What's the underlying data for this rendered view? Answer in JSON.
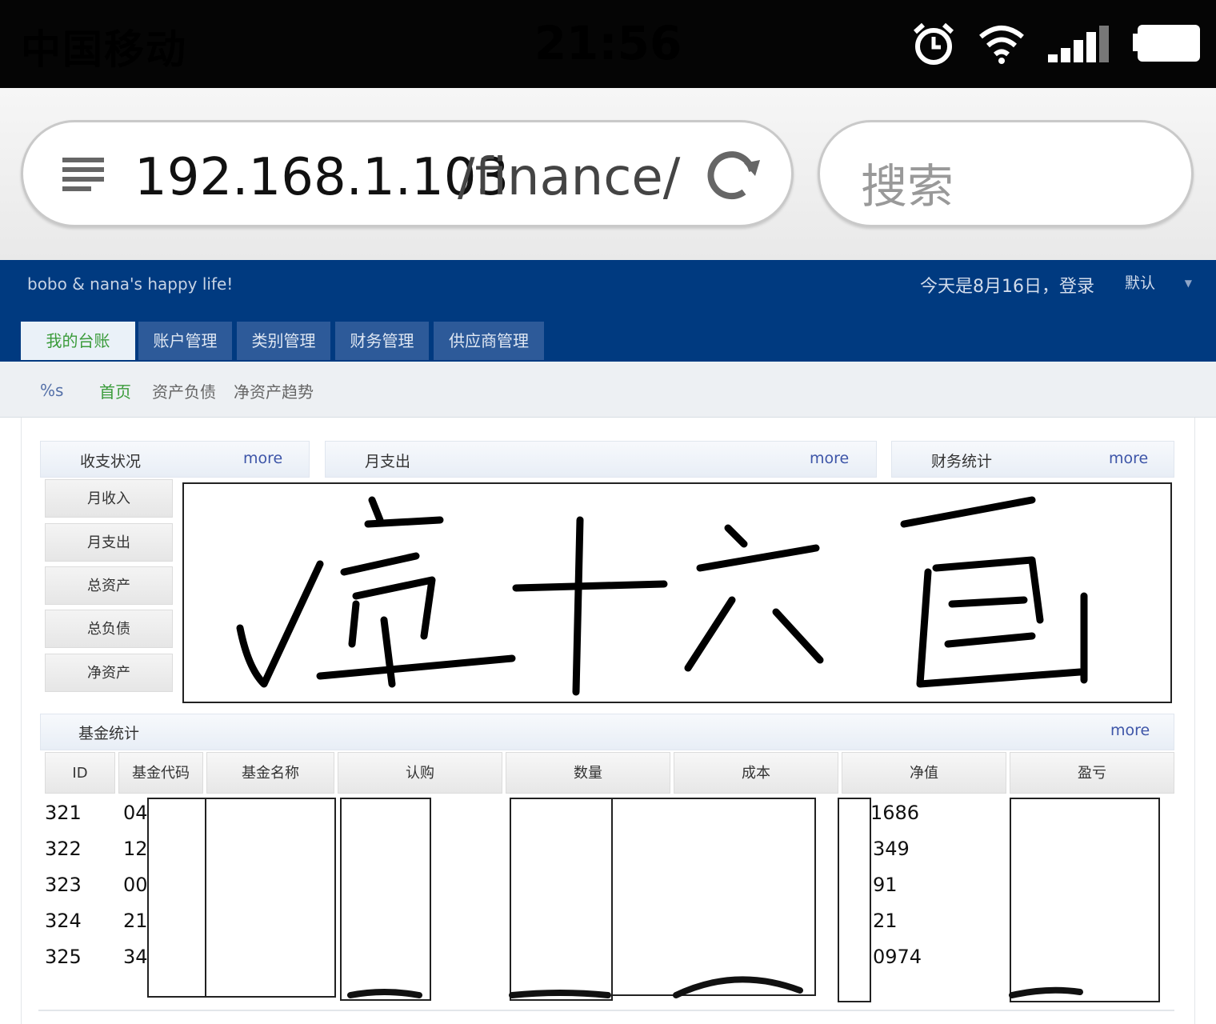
{
  "status_bar": {
    "carrier": "中国移动",
    "time": "21:56"
  },
  "browser": {
    "url_host": "192.168.1.103",
    "url_path": "/finance/w",
    "search_placeholder": "搜索"
  },
  "site": {
    "title": "bobo & nana's happy life!",
    "date_login": "今天是8月16日，登录",
    "user_select": "默认"
  },
  "tabs": [
    "我的台账",
    "账户管理",
    "类别管理",
    "财务管理",
    "供应商管理"
  ],
  "subnav": {
    "prefix": "%s",
    "items": [
      "首页",
      "资产负债",
      "净资产趋势"
    ]
  },
  "panels": {
    "income": {
      "title": "收支状况",
      "more": "more",
      "rows": [
        "月收入",
        "月支出",
        "总资产",
        "总负债",
        "净资产"
      ]
    },
    "monthly": {
      "title": "月支出",
      "more": "more"
    },
    "stats": {
      "title": "财务统计",
      "more": "more"
    },
    "fund": {
      "title": "基金统计",
      "more": "more",
      "columns": [
        "ID",
        "基金代码",
        "基金名称",
        "认购",
        "数量",
        "成本",
        "净值",
        "盈亏"
      ],
      "rows": [
        {
          "id": "321",
          "code": "04",
          "nav": "1686"
        },
        {
          "id": "322",
          "code": "12",
          "nav": "349"
        },
        {
          "id": "323",
          "code": "00",
          "nav": "91"
        },
        {
          "id": "324",
          "code": "21",
          "nav": "21"
        },
        {
          "id": "325",
          "code": "34",
          "nav": "0974"
        }
      ]
    }
  },
  "handwriting": "壹十六画",
  "colors": {
    "header_blue": "#003a80",
    "tab_blue": "#2d5a99",
    "active_green": "#3a9b3a",
    "more_blue": "#3d55a8"
  }
}
